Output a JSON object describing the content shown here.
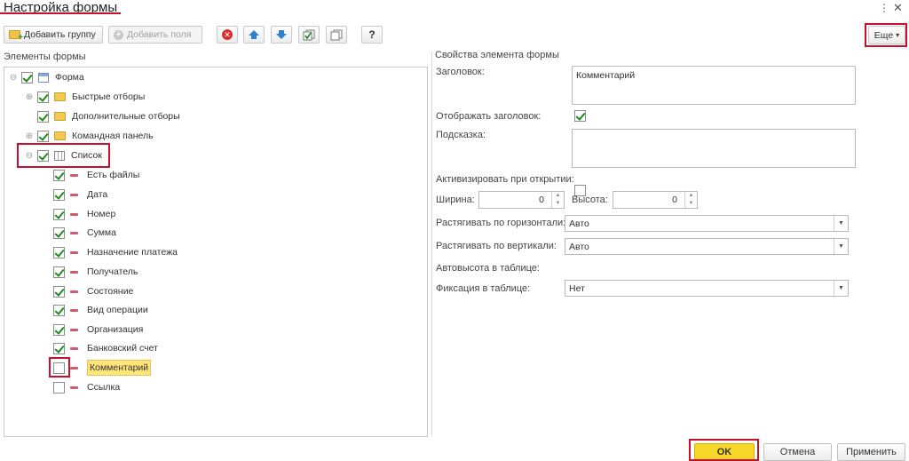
{
  "window": {
    "title": "Настройка формы",
    "menu_icon": "vertical-ellipsis-icon",
    "close_icon": "close-icon"
  },
  "toolbar": {
    "add_group_label": "Добавить группу",
    "add_fields_label": "Добавить поля",
    "help_label": "?",
    "more_label": "Еще",
    "more_arrow": "▾"
  },
  "left_panel": {
    "title": "Элементы формы",
    "tree": [
      {
        "label": "Форма",
        "checked": true,
        "icon": "form-icon"
      },
      {
        "label": "Быстрые отборы",
        "checked": true,
        "icon": "folder-icon"
      },
      {
        "label": "Дополнительные отборы",
        "checked": true,
        "icon": "folder-icon"
      },
      {
        "label": "Командная панель",
        "checked": true,
        "icon": "folder-icon"
      },
      {
        "label": "Список",
        "checked": true,
        "icon": "table-icon"
      },
      {
        "label": "Есть файлы",
        "checked": true,
        "icon": "field-icon"
      },
      {
        "label": "Дата",
        "checked": true,
        "icon": "field-icon"
      },
      {
        "label": "Номер",
        "checked": true,
        "icon": "field-icon"
      },
      {
        "label": "Сумма",
        "checked": true,
        "icon": "field-icon"
      },
      {
        "label": "Назначение платежа",
        "checked": true,
        "icon": "field-icon"
      },
      {
        "label": "Получатель",
        "checked": true,
        "icon": "field-icon"
      },
      {
        "label": "Состояние",
        "checked": true,
        "icon": "field-icon"
      },
      {
        "label": "Вид операции",
        "checked": true,
        "icon": "field-icon"
      },
      {
        "label": "Организация",
        "checked": true,
        "icon": "field-icon"
      },
      {
        "label": "Банковский счет",
        "checked": true,
        "icon": "field-icon"
      },
      {
        "label": "Комментарий",
        "checked": false,
        "icon": "field-icon"
      },
      {
        "label": "Ссылка",
        "checked": false,
        "icon": "field-icon"
      }
    ]
  },
  "props": {
    "title": "Свойства элемента формы",
    "heading_label": "Заголовок:",
    "heading_value": "Комментарий",
    "show_heading_label": "Отображать заголовок:",
    "show_heading_checked": true,
    "hint_label": "Подсказка:",
    "hint_value": "",
    "activate_label": "Активизировать при открытии:",
    "activate_checked": false,
    "width_label": "Ширина:",
    "width_value": "0",
    "height_label": "Высота:",
    "height_value": "0",
    "stretch_h_label": "Растягивать по горизонтали:",
    "stretch_h_value": "Авто",
    "stretch_v_label": "Растягивать по вертикали:",
    "stretch_v_value": "Авто",
    "autoheight_label": "Автовысота в таблице:",
    "autoheight_checked": false,
    "fix_label": "Фиксация в таблице:",
    "fix_value": "Нет"
  },
  "footer": {
    "ok_label": "OK",
    "cancel_label": "Отмена",
    "apply_label": "Применить"
  },
  "colors": {
    "highlight_red": "#c8102e",
    "ok_yellow": "#f7d62a",
    "selection_yellow": "#ffe57a",
    "check_green": "#1e8a1e"
  }
}
